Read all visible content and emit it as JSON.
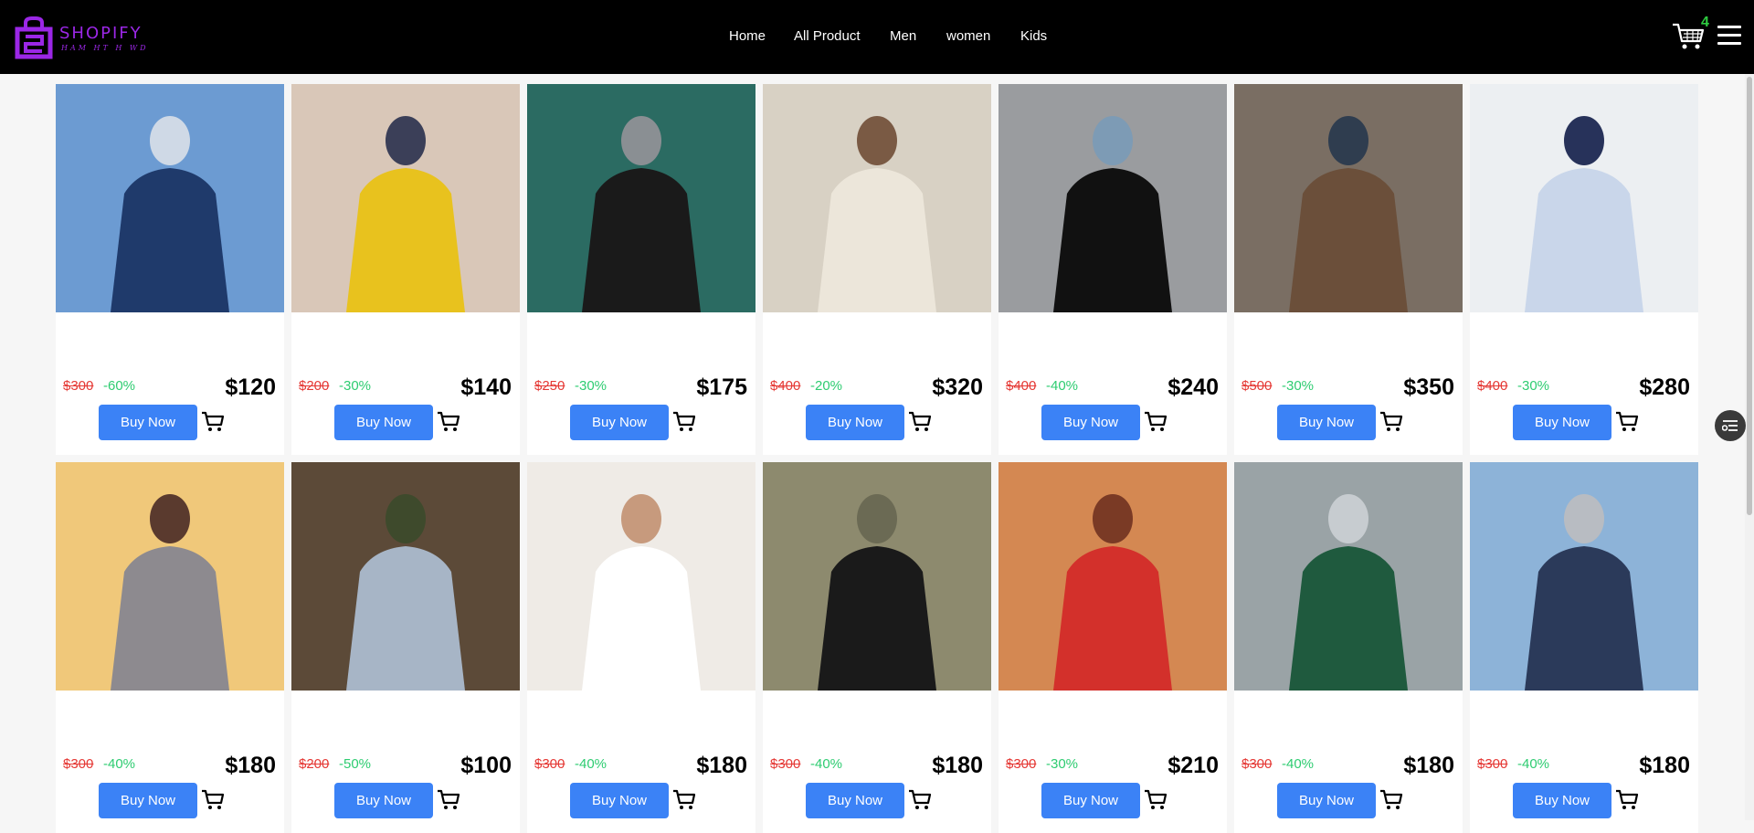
{
  "brand": {
    "name": "SHOPIFY",
    "tagline": "HAM HT H WD",
    "color": "#9b27e6"
  },
  "nav": {
    "links": [
      {
        "label": "Home"
      },
      {
        "label": "All Product"
      },
      {
        "label": "Men"
      },
      {
        "label": "women"
      },
      {
        "label": "Kids"
      }
    ]
  },
  "cart": {
    "count": "4",
    "icon": "shopping-cart-icon"
  },
  "menu": {
    "icon": "hamburger-menu-icon"
  },
  "buy_label": "Buy Now",
  "colors": {
    "navbar": "#000000",
    "button": "#3b82f6",
    "old_price": "#e53935",
    "discount": "#2ecc71",
    "cart_count": "#2ecc40"
  },
  "products": [
    {
      "old_price": "$300",
      "discount": "-60%",
      "price": "$120",
      "image": "man in navy suit near glass towers"
    },
    {
      "old_price": "$200",
      "discount": "-30%",
      "price": "$140",
      "image": "men in yellow and grey blazers on street"
    },
    {
      "old_price": "$250",
      "discount": "-30%",
      "price": "$175",
      "image": "man in black leather jacket and sunglasses"
    },
    {
      "old_price": "$400",
      "discount": "-20%",
      "price": "$320",
      "image": "cream cable-knit sweater close-up"
    },
    {
      "old_price": "$400",
      "discount": "-40%",
      "price": "$240",
      "image": "man in black tee leaning on grey wall"
    },
    {
      "old_price": "$500",
      "discount": "-30%",
      "price": "$350",
      "image": "man in brown tweed blazer"
    },
    {
      "old_price": "$400",
      "discount": "-30%",
      "price": "$280",
      "image": "folded dress shirts on white"
    },
    {
      "old_price": "$300",
      "discount": "-40%",
      "price": "$180",
      "image": "woman in grey hoodie"
    },
    {
      "old_price": "$200",
      "discount": "-50%",
      "price": "$100",
      "image": "woman in denim jacket in forest"
    },
    {
      "old_price": "$300",
      "discount": "-40%",
      "price": "$180",
      "image": "white lace skirt and bare feet"
    },
    {
      "old_price": "$300",
      "discount": "-40%",
      "price": "$180",
      "image": "woman in black dress in field"
    },
    {
      "old_price": "$300",
      "discount": "-30%",
      "price": "$210",
      "image": "woman in red outfit on orange backdrop"
    },
    {
      "old_price": "$300",
      "discount": "-40%",
      "price": "$180",
      "image": "woman in green floral dress jumping"
    },
    {
      "old_price": "$300",
      "discount": "-40%",
      "price": "$180",
      "image": "woman in sweatpants on rooftop"
    }
  ]
}
